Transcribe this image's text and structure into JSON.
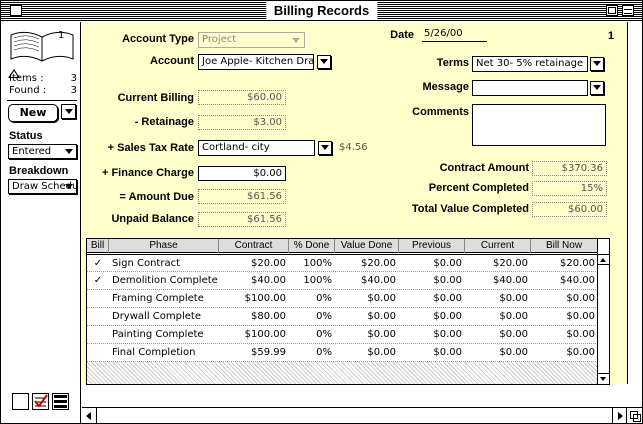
{
  "window": {
    "title": "Billing Records"
  },
  "sidebar": {
    "book_page": "1",
    "items_label": "Items :",
    "items_count": "3",
    "found_label": "Found :",
    "found_count": "3",
    "new_label": "New",
    "status_label": "Status",
    "status_value": "Entered",
    "breakdown_label": "Breakdown",
    "breakdown_value": "Draw Schedule"
  },
  "form": {
    "record_number": "1",
    "account_type_label": "Account Type",
    "account_type_value": "Project",
    "account_label": "Account",
    "account_value": "Joe Apple- Kitchen Draw",
    "date_label": "Date",
    "date_value": "5/26/00",
    "terms_label": "Terms",
    "terms_value": "Net 30- 5% retainage",
    "message_label": "Message",
    "message_value": "",
    "comments_label": "Comments",
    "comments_value": "",
    "current_billing_label": "Current Billing",
    "current_billing_value": "$60.00",
    "retainage_label": "- Retainage",
    "retainage_value": "$3.00",
    "sales_tax_label": "+ Sales Tax Rate",
    "sales_tax_value": "Cortland- city",
    "sales_tax_amount": "$4.56",
    "finance_charge_label": "+ Finance Charge",
    "finance_charge_value": "$0.00",
    "amount_due_label": "= Amount Due",
    "amount_due_value": "$61.56",
    "unpaid_balance_label": "Unpaid Balance",
    "unpaid_balance_value": "$61.56",
    "contract_amount_label": "Contract Amount",
    "contract_amount_value": "$370.36",
    "percent_completed_label": "Percent Completed",
    "percent_completed_value": "15%",
    "total_value_label": "Total Value Completed",
    "total_value_value": "$60.00"
  },
  "table": {
    "headers": [
      "Bill",
      "Phase",
      "Contract",
      "% Done",
      "Value Done",
      "Previous",
      "Current",
      "Bill Now"
    ],
    "rows": [
      [
        "✓",
        "Sign Contract",
        "$20.00",
        "100%",
        "$20.00",
        "$0.00",
        "$20.00",
        "$20.00"
      ],
      [
        "✓",
        "Demolition Complete",
        "$40.00",
        "100%",
        "$40.00",
        "$0.00",
        "$40.00",
        "$40.00"
      ],
      [
        "",
        "Framing Complete",
        "$100.00",
        "0%",
        "$0.00",
        "$0.00",
        "$0.00",
        "$0.00"
      ],
      [
        "",
        "Drywall Complete",
        "$80.00",
        "0%",
        "$0.00",
        "$0.00",
        "$0.00",
        "$0.00"
      ],
      [
        "",
        "Painting Complete",
        "$100.00",
        "0%",
        "$0.00",
        "$0.00",
        "$0.00",
        "$0.00"
      ],
      [
        "",
        "Final Completion",
        "$59.99",
        "0%",
        "$0.00",
        "$0.00",
        "$0.00",
        "$0.00"
      ]
    ]
  }
}
